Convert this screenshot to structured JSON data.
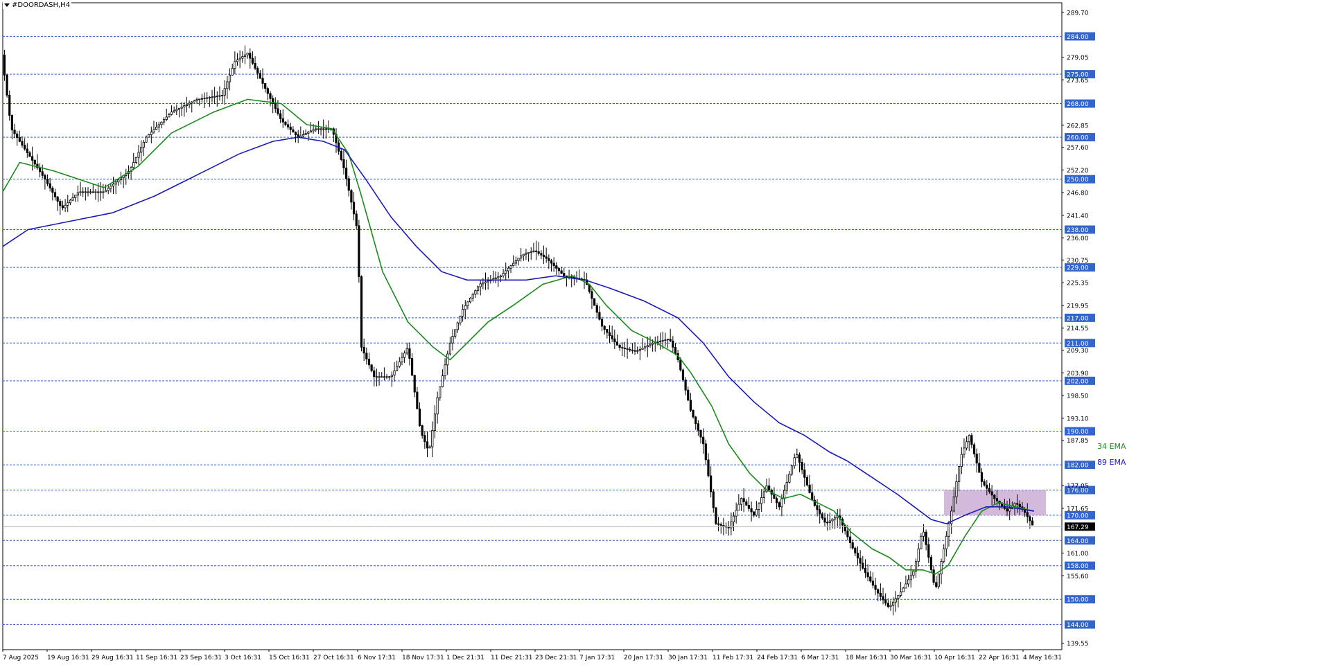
{
  "window": {
    "title": "#DOORDASH,H4"
  },
  "legend": {
    "ema34": "34 EMA",
    "ema89": "89 EMA"
  },
  "colors": {
    "ema34": "#1a8a1a",
    "ema89": "#1a1ab4",
    "level_line": "#2e5fd1",
    "level_badge": "#3366cc",
    "candle": "#000000",
    "zone": "#cdaed3",
    "current_price_badge": "#000000"
  },
  "chart_data": {
    "type": "candlestick",
    "symbol": "#DOORDASH",
    "timeframe": "H4",
    "ylim": [
      138.0,
      292.0
    ],
    "y_tick_labels": [
      "289.70",
      "279.05",
      "273.65",
      "262.85",
      "257.60",
      "252.20",
      "246.80",
      "241.40",
      "236.00",
      "230.75",
      "225.35",
      "219.95",
      "214.55",
      "209.30",
      "203.90",
      "198.50",
      "193.10",
      "187.85",
      "177.05",
      "171.65",
      "161.00",
      "155.60",
      "139.55"
    ],
    "x_tick_labels": [
      "7 Aug 2025",
      "19 Aug 16:31",
      "29 Aug 16:31",
      "11 Sep 16:31",
      "23 Sep 16:31",
      "3 Oct 16:31",
      "15 Oct 16:31",
      "27 Oct 16:31",
      "6 Nov 17:31",
      "18 Nov 17:31",
      "1 Dec 21:31",
      "11 Dec 21:31",
      "23 Dec 21:31",
      "7 Jan 17:31",
      "20 Jan 17:31",
      "30 Jan 17:31",
      "11 Feb 17:31",
      "24 Feb 17:31",
      "6 Mar 17:31",
      "18 Mar 16:31",
      "30 Mar 16:31",
      "10 Apr 16:31",
      "22 Apr 16:31",
      "4 May 16:31"
    ],
    "horizontal_levels": [
      "284.00",
      "275.00",
      "268.00",
      "260.00",
      "250.00",
      "238.00",
      "229.00",
      "217.00",
      "211.00",
      "202.00",
      "190.00",
      "182.00",
      "176.00",
      "170.00",
      "164.00",
      "158.00",
      "150.00",
      "144.00"
    ],
    "current_price": "167.29",
    "zone": {
      "from_date": "10 Apr 16:31",
      "price_low": 170.0,
      "price_high": 176.0
    },
    "series": [
      {
        "name": "34 EMA",
        "type": "line",
        "points": [
          [
            0,
            247
          ],
          [
            20,
            254
          ],
          [
            60,
            252
          ],
          [
            120,
            248
          ],
          [
            160,
            253
          ],
          [
            200,
            261
          ],
          [
            250,
            266
          ],
          [
            290,
            269
          ],
          [
            330,
            268
          ],
          [
            360,
            263
          ],
          [
            390,
            262
          ],
          [
            410,
            256
          ],
          [
            425,
            246
          ],
          [
            450,
            228
          ],
          [
            480,
            216
          ],
          [
            510,
            210
          ],
          [
            530,
            207
          ],
          [
            550,
            211
          ],
          [
            575,
            216
          ],
          [
            605,
            220
          ],
          [
            640,
            225
          ],
          [
            675,
            227
          ],
          [
            695,
            225
          ],
          [
            715,
            220
          ],
          [
            745,
            214
          ],
          [
            775,
            211
          ],
          [
            800,
            208
          ],
          [
            815,
            204
          ],
          [
            840,
            196
          ],
          [
            860,
            187
          ],
          [
            885,
            180
          ],
          [
            905,
            176
          ],
          [
            925,
            174
          ],
          [
            945,
            175
          ],
          [
            965,
            173
          ],
          [
            985,
            171
          ],
          [
            1005,
            166
          ],
          [
            1030,
            162
          ],
          [
            1050,
            160
          ],
          [
            1070,
            157
          ],
          [
            1090,
            157
          ],
          [
            1105,
            156
          ],
          [
            1120,
            158
          ],
          [
            1140,
            165
          ],
          [
            1160,
            171
          ],
          [
            1180,
            173
          ],
          [
            1200,
            172
          ],
          [
            1222,
            171
          ]
        ]
      },
      {
        "name": "89 EMA",
        "type": "line",
        "points": [
          [
            0,
            234
          ],
          [
            30,
            238
          ],
          [
            80,
            240
          ],
          [
            130,
            242
          ],
          [
            180,
            246
          ],
          [
            230,
            251
          ],
          [
            280,
            256
          ],
          [
            320,
            259
          ],
          [
            350,
            260
          ],
          [
            380,
            259
          ],
          [
            405,
            257
          ],
          [
            430,
            250
          ],
          [
            460,
            241
          ],
          [
            490,
            234
          ],
          [
            520,
            228
          ],
          [
            550,
            226
          ],
          [
            580,
            226
          ],
          [
            620,
            226
          ],
          [
            655,
            227
          ],
          [
            690,
            226
          ],
          [
            720,
            224
          ],
          [
            760,
            221
          ],
          [
            800,
            217
          ],
          [
            830,
            211
          ],
          [
            860,
            203
          ],
          [
            890,
            197
          ],
          [
            920,
            192
          ],
          [
            950,
            189
          ],
          [
            980,
            185
          ],
          [
            1000,
            183
          ],
          [
            1030,
            179
          ],
          [
            1060,
            175
          ],
          [
            1080,
            172
          ],
          [
            1100,
            169
          ],
          [
            1118,
            168
          ],
          [
            1140,
            170
          ],
          [
            1165,
            172
          ],
          [
            1190,
            172
          ],
          [
            1222,
            171
          ]
        ]
      }
    ]
  }
}
